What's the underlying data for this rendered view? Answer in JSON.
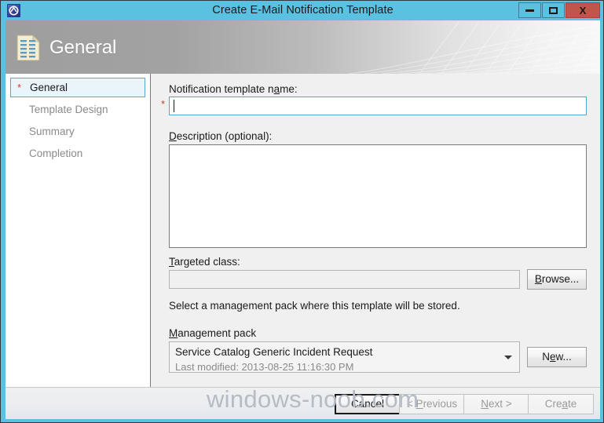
{
  "window": {
    "title": "Create E-Mail Notification Template",
    "app_icon": "notification-template-icon",
    "controls": {
      "minimize": "minimize-icon",
      "maximize": "maximize-icon",
      "close": "X"
    }
  },
  "header": {
    "title": "General",
    "icon": "document-template-icon"
  },
  "sidebar": {
    "items": [
      {
        "label": "General",
        "selected": true,
        "required": true,
        "required_marker": "*"
      },
      {
        "label": "Template Design",
        "selected": false,
        "required": false
      },
      {
        "label": "Summary",
        "selected": false,
        "required": false
      },
      {
        "label": "Completion",
        "selected": false,
        "required": false
      }
    ]
  },
  "form": {
    "name": {
      "label_pre": "Notification template n",
      "label_accel": "a",
      "label_post": "me:",
      "required_marker": "*",
      "value": "",
      "placeholder": ""
    },
    "description": {
      "label_accel": "D",
      "label_post": "escription (optional):",
      "value": "",
      "placeholder": ""
    },
    "targeted_class": {
      "label_accel": "T",
      "label_post": "argeted class:",
      "value": "",
      "placeholder": "",
      "browse_button": {
        "pre": "",
        "accel": "B",
        "post": "rowse..."
      }
    },
    "management_pack_helper": "Select a management pack where this template will be stored.",
    "management_pack": {
      "label_accel": "M",
      "label_post": "anagement pack",
      "selected": "Service Catalog Generic Incident Request",
      "last_modified": "Last modified:  2013-08-25 11:16:30 PM",
      "new_button": {
        "pre": "N",
        "accel": "e",
        "post": "w..."
      }
    }
  },
  "footer": {
    "buttons": [
      {
        "id": "cancel",
        "pre": "Cancel",
        "accel": "",
        "post": "",
        "state": "default"
      },
      {
        "id": "previous",
        "pre": "< ",
        "accel": "P",
        "post": "revious",
        "state": "disabled"
      },
      {
        "id": "next",
        "pre": "",
        "accel": "N",
        "post": "ext >",
        "state": "disabled"
      },
      {
        "id": "create",
        "pre": "Cre",
        "accel": "a",
        "post": "te",
        "state": "disabled"
      }
    ]
  },
  "watermark": {
    "text": "windows-noob.com"
  },
  "colors": {
    "title_bar": "#5bc1e0",
    "close_button": "#c0554a",
    "accent_focus": "#4aa8cf",
    "required": "#d23b2e",
    "body_bg": "#f0f0f0",
    "sidebar_bg": "#ffffff",
    "disabled_text": "#9a9a9a"
  }
}
